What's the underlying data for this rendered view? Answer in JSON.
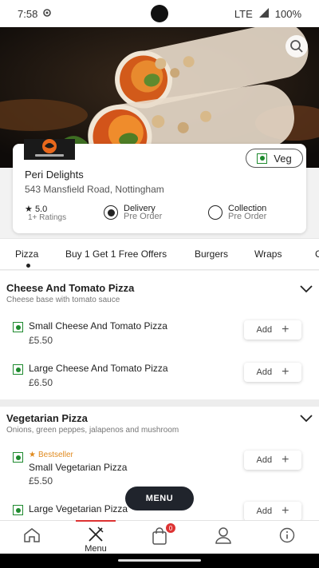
{
  "status_bar": {
    "time": "7:58",
    "network": "LTE",
    "battery": "100%"
  },
  "restaurant": {
    "logo_text": "peri delights",
    "name": "Peri Delights",
    "address": "543 Mansfield Road, Nottingham",
    "rating": "5.0",
    "rating_count": "1+ Ratings",
    "veg_label": "Veg",
    "delivery_label": "Delivery",
    "delivery_sub": "Pre Order",
    "collection_label": "Collection",
    "collection_sub": "Pre Order",
    "selected_mode": "Delivery"
  },
  "tabs": [
    {
      "label": "Pizza",
      "active": true
    },
    {
      "label": "Buy 1 Get 1 Free Offers"
    },
    {
      "label": "Burgers"
    },
    {
      "label": "Wraps"
    },
    {
      "label": "C"
    }
  ],
  "sections": [
    {
      "title": "Cheese And Tomato Pizza",
      "description": "Cheese base with tomato sauce",
      "items": [
        {
          "name": "Small Cheese And Tomato Pizza",
          "price": "£5.50",
          "add_label": "Add"
        },
        {
          "name": "Large Cheese And Tomato Pizza",
          "price": "£6.50",
          "add_label": "Add"
        }
      ]
    },
    {
      "title": "Vegetarian Pizza",
      "description": "Onions, green peppes, jalapenos and mushroom",
      "items": [
        {
          "badge": "Bestseller",
          "name": "Small Vegetarian Pizza",
          "price": "£5.50",
          "add_label": "Add"
        },
        {
          "name": "Large Vegetarian Pizza",
          "price": "",
          "add_label": "Add"
        }
      ]
    }
  ],
  "menu_button": "MENU",
  "bottom_nav": {
    "menu_label": "Menu",
    "cart_count": "0"
  },
  "colors": {
    "veg_green": "#1e8a2e",
    "bestseller_orange": "#e08a1e",
    "badge_red": "#d33",
    "menu_button_bg": "#20242c"
  }
}
